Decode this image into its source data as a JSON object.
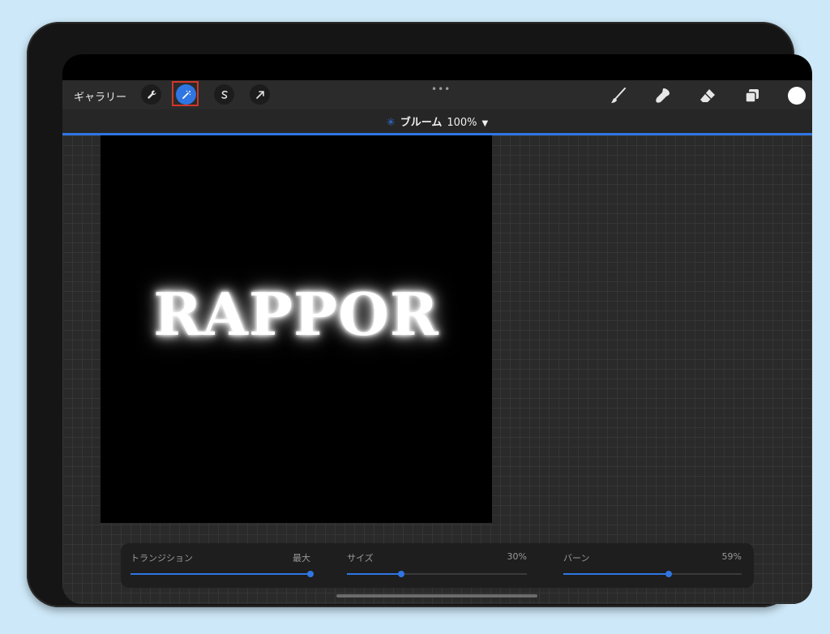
{
  "toolbar": {
    "gallery_label": "ギャラリー",
    "left_tools": [
      {
        "icon": "wrench-icon"
      },
      {
        "icon": "magic-wand-icon",
        "active": true
      },
      {
        "icon": "selection-icon"
      },
      {
        "icon": "transform-arrow-icon"
      }
    ],
    "more_dots": "•••",
    "right_tools": [
      {
        "icon": "brush-icon"
      },
      {
        "icon": "smudge-icon"
      },
      {
        "icon": "eraser-icon"
      },
      {
        "icon": "layers-icon"
      }
    ],
    "active_color": "#ffffff"
  },
  "adjustment": {
    "icon": "bloom-star-icon",
    "name": "ブルーム",
    "percent": "100%",
    "dropdown_icon": "triangle-down-icon"
  },
  "canvas": {
    "text": "RAPPOR"
  },
  "sliders": [
    {
      "label": "トランジション",
      "value_text": "最大",
      "fraction": 1.0
    },
    {
      "label": "サイズ",
      "value_text": "30%",
      "fraction": 0.3
    },
    {
      "label": "バーン",
      "value_text": "59%",
      "fraction": 0.59
    }
  ],
  "colors": {
    "accent": "#2f76e3",
    "highlight_frame": "#d1362a",
    "background": "#cde8f8"
  }
}
